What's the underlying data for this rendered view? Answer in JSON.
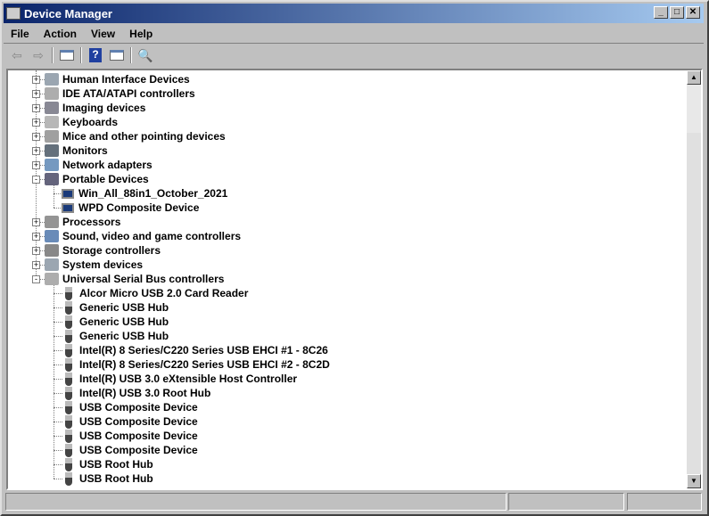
{
  "title": "Device Manager",
  "menu": [
    "File",
    "Action",
    "View",
    "Help"
  ],
  "toolbar": [
    "back-icon",
    "forward-icon",
    "show-hide-console-tree-icon",
    "help-icon",
    "show-action-pane-icon",
    "scan-hardware-icon"
  ],
  "tree": [
    {
      "label": "Human Interface Devices",
      "level": 0,
      "expander": "+"
    },
    {
      "label": "IDE ATA/ATAPI controllers",
      "level": 0,
      "expander": "+"
    },
    {
      "label": "Imaging devices",
      "level": 0,
      "expander": "+"
    },
    {
      "label": "Keyboards",
      "level": 0,
      "expander": "+"
    },
    {
      "label": "Mice and other pointing devices",
      "level": 0,
      "expander": "+"
    },
    {
      "label": "Monitors",
      "level": 0,
      "expander": "+"
    },
    {
      "label": "Network adapters",
      "level": 0,
      "expander": "+"
    },
    {
      "label": "Portable Devices",
      "level": 0,
      "expander": "-"
    },
    {
      "label": "Win_All_88in1_October_2021",
      "level": 1
    },
    {
      "label": "WPD Composite Device",
      "level": 1
    },
    {
      "label": "Processors",
      "level": 0,
      "expander": "+"
    },
    {
      "label": "Sound, video and game controllers",
      "level": 0,
      "expander": "+"
    },
    {
      "label": "Storage controllers",
      "level": 0,
      "expander": "+"
    },
    {
      "label": "System devices",
      "level": 0,
      "expander": "+"
    },
    {
      "label": "Universal Serial Bus controllers",
      "level": 0,
      "expander": "-"
    },
    {
      "label": "Alcor Micro USB 2.0 Card Reader",
      "level": 1
    },
    {
      "label": "Generic USB Hub",
      "level": 1
    },
    {
      "label": "Generic USB Hub",
      "level": 1
    },
    {
      "label": "Generic USB Hub",
      "level": 1
    },
    {
      "label": "Intel(R) 8 Series/C220 Series USB EHCI #1 - 8C26",
      "level": 1
    },
    {
      "label": "Intel(R) 8 Series/C220 Series USB EHCI #2 - 8C2D",
      "level": 1
    },
    {
      "label": "Intel(R) USB 3.0 eXtensible Host Controller",
      "level": 1
    },
    {
      "label": "Intel(R) USB 3.0 Root Hub",
      "level": 1
    },
    {
      "label": "USB Composite Device",
      "level": 1
    },
    {
      "label": "USB Composite Device",
      "level": 1
    },
    {
      "label": "USB Composite Device",
      "level": 1
    },
    {
      "label": "USB Composite Device",
      "level": 1
    },
    {
      "label": "USB Root Hub",
      "level": 1
    },
    {
      "label": "USB Root Hub",
      "level": 1
    }
  ]
}
